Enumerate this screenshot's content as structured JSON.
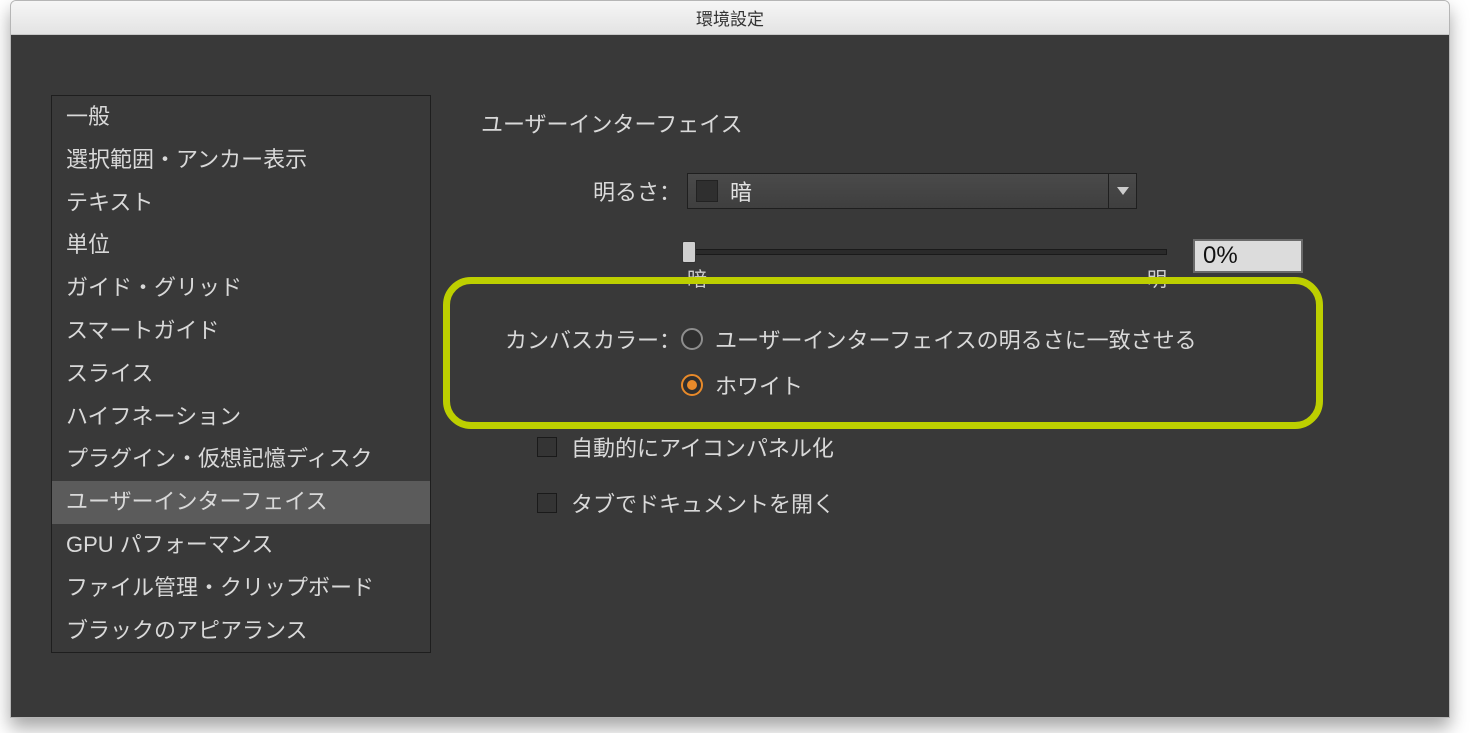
{
  "window": {
    "title": "環境設定"
  },
  "sidebar": {
    "items": [
      "一般",
      "選択範囲・アンカー表示",
      "テキスト",
      "単位",
      "ガイド・グリッド",
      "スマートガイド",
      "スライス",
      "ハイフネーション",
      "プラグイン・仮想記憶ディスク",
      "ユーザーインターフェイス",
      "GPU パフォーマンス",
      "ファイル管理・クリップボード",
      "ブラックのアピアランス"
    ],
    "selected_index": 9
  },
  "main": {
    "section_title": "ユーザーインターフェイス",
    "brightness": {
      "label": "明るさ：",
      "value": "暗",
      "slider_min_label": "暗",
      "slider_max_label": "明",
      "percent": "0%"
    },
    "canvas_color": {
      "label": "カンバスカラー：",
      "option_match": "ユーザーインターフェイスの明るさに一致させる",
      "option_white": "ホワイト",
      "selected": "white"
    },
    "checkbox_auto_iconify": "自動的にアイコンパネル化",
    "checkbox_open_as_tabs": "タブでドキュメントを開く"
  }
}
